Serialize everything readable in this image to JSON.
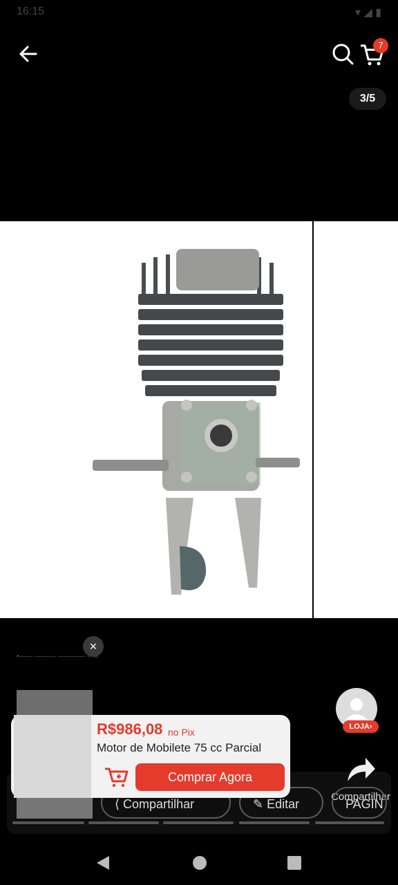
{
  "status": {
    "time": "16:15"
  },
  "counter": "3/5",
  "cart": {
    "badge": "7"
  },
  "preview": {
    "close": "×",
    "dim_text": "•—— ——— ————  ○ ↻"
  },
  "store": {
    "badge": "LOJA›"
  },
  "product": {
    "price": "R$986,08",
    "price_note": "no Pix",
    "title": "Motor de Mobilete 75 cc Parcial",
    "buy_label": "Comprar Agora"
  },
  "actions": {
    "share_right_label": "Compartilhar",
    "share_label": "Compartilhar",
    "edit_label": "Editar",
    "page_label": "PAGIN"
  }
}
